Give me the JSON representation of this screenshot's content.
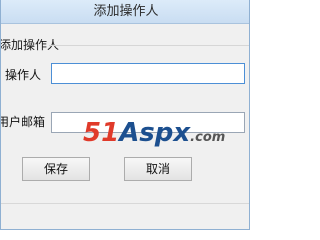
{
  "window": {
    "title": "添加操作人"
  },
  "group": {
    "title": "添加操作人"
  },
  "fields": {
    "operator_label": "操作人",
    "operator_value": "",
    "email_label": "用户邮箱",
    "email_value": ""
  },
  "buttons": {
    "save": "保存",
    "cancel": "取消"
  },
  "watermark": {
    "part1": "51",
    "part2": "Aspx",
    "part3": ".com"
  }
}
